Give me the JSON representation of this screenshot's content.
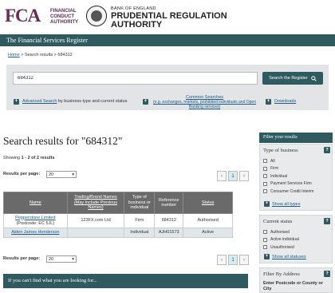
{
  "header": {
    "fca_logo": "FCA",
    "fca_lines": [
      "FINANCIAL",
      "CONDUCT",
      "AUTHORITY"
    ],
    "boe_line": "BANK OF ENGLAND",
    "pra_line1": "PRUDENTIAL REGULATION",
    "pra_line2": "AUTHORITY"
  },
  "titlebar": "The Financial Services Register",
  "breadcrumb": {
    "home": "Home",
    "sep1": ">",
    "results": "Search results",
    "sep2": ">",
    "current": "684312"
  },
  "search": {
    "value": "684312",
    "button": "Search the Register",
    "advanced": "Advanced Search",
    "advanced_suffix": "by business type and current status",
    "common": "Common Searches",
    "common_sub": "(e.g. exchanges, markets, prohibited individuals and Open Banking services)",
    "downloads": "Downloads"
  },
  "results": {
    "title": "Search results for \"684312\"",
    "showing_prefix": "Showing",
    "showing_range": "1 - 2 of 2 results",
    "rpp_label": "Results per page:",
    "rpp_value": "20",
    "page": "1"
  },
  "table": {
    "headers": {
      "name": "Name",
      "trading_1": "Trading/Brand Names",
      "trading_2": "(May include Previous",
      "trading_3": "Names)",
      "type": [
        "Type of",
        "business or",
        "individual"
      ],
      "ref": [
        "Reference",
        "number"
      ],
      "status": "Status"
    },
    "rows": [
      {
        "name": "Pepperstone Limited",
        "postcode": "(Postcode: EC 5JL)",
        "trading": "123FX.com Ltd",
        "type": "Firm",
        "ref": "684312",
        "status": "Authorised"
      },
      {
        "name": "Alden James Henderson",
        "postcode": "",
        "trading": "",
        "type": "Individual",
        "ref": "AJH01573",
        "status": "Active"
      }
    ]
  },
  "bottom_bar": "If you can't find what you are looking for...",
  "sidebar": {
    "filter_title": "Filter your results",
    "business_type": {
      "title": "Type of business",
      "items": [
        "All",
        "Firm",
        "Individual",
        "Payment Services Firm",
        "Consumer Credit Interim"
      ],
      "show_all": "Show all types"
    },
    "current_status": {
      "title": "Current status",
      "items": [
        "Authorised",
        "Active individual",
        "Unauthorised"
      ],
      "show_all": "Show all statuses"
    },
    "address": {
      "title": "Filter By Address",
      "label": "Enter Postcode or County or City"
    },
    "help": "?"
  }
}
